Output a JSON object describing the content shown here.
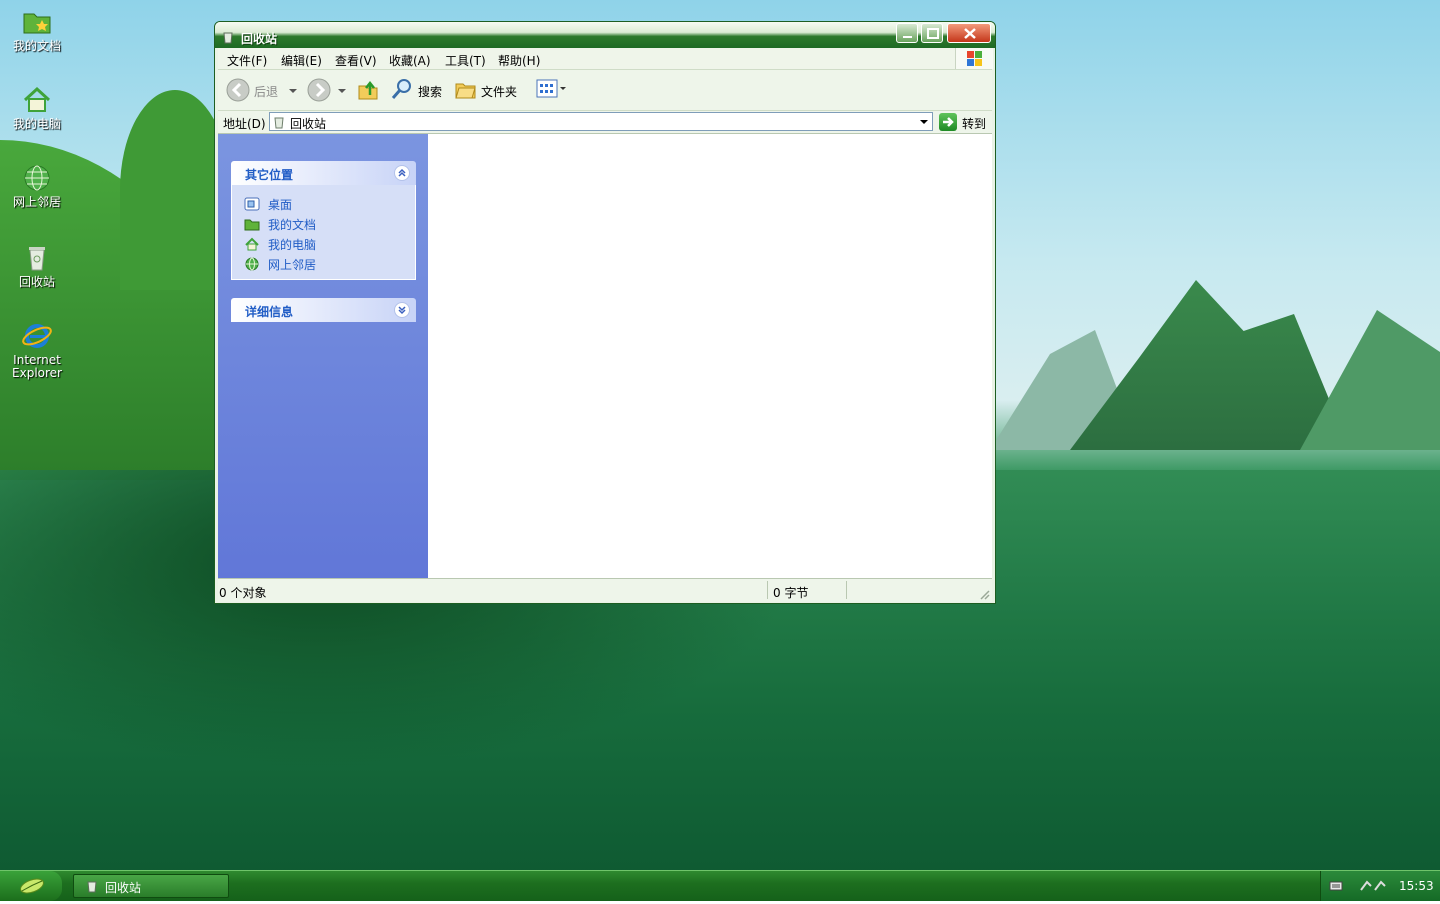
{
  "desktop": {
    "icons": [
      {
        "label": "我的文档",
        "icon": "folder-documents-icon"
      },
      {
        "label": "我的电脑",
        "icon": "computer-home-icon"
      },
      {
        "label": "网上邻居",
        "icon": "network-globe-icon"
      },
      {
        "label": "回收站",
        "icon": "recycle-bin-icon"
      },
      {
        "label_line1": "Internet",
        "label_line2": "Explorer",
        "icon": "internet-explorer-icon"
      }
    ]
  },
  "window": {
    "title": "回收站",
    "menu": [
      "文件(F)",
      "编辑(E)",
      "查看(V)",
      "收藏(A)",
      "工具(T)",
      "帮助(H)"
    ],
    "toolbar": {
      "back": "后退",
      "search": "搜索",
      "folders": "文件夹"
    },
    "address": {
      "label": "地址(D)",
      "value": "回收站",
      "go": "转到"
    },
    "tasks": {
      "other_places": {
        "title": "其它位置",
        "links": [
          {
            "label": "桌面",
            "icon": "desktop-icon"
          },
          {
            "label": "我的文档",
            "icon": "folder-icon"
          },
          {
            "label": "我的电脑",
            "icon": "computer-icon"
          },
          {
            "label": "网上邻居",
            "icon": "network-icon"
          }
        ]
      },
      "details": {
        "title": "详细信息"
      }
    },
    "status": {
      "objects": "0 个对象",
      "size": "0 字节"
    }
  },
  "taskbar": {
    "item": "回收站",
    "clock": "15:53"
  },
  "colors": {
    "title_green": "#1e6a24",
    "task_pane_blue": "#6b82dc",
    "link_blue": "#215dc6"
  }
}
